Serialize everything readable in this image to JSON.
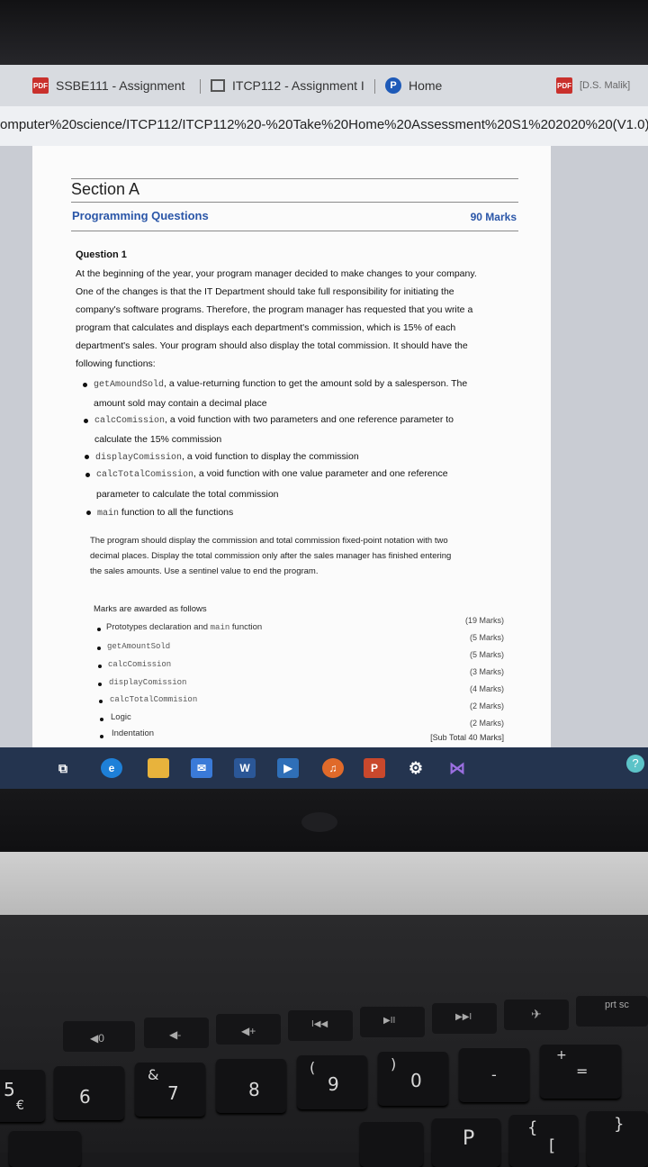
{
  "browser": {
    "tabs": [
      {
        "label": "SSBE111 - Assignment"
      },
      {
        "label": "ITCP112 - Assignment I"
      },
      {
        "label": "Home"
      },
      {
        "label": "[D.S. Malik] "
      }
    ],
    "address": "omputer%20science/ITCP112/ITCP112%20-%20Take%20Home%20Assessment%20S1%202020%20(V1.0).pdf"
  },
  "document": {
    "section_title": "Section A",
    "subsection_title": "Programming Questions",
    "subsection_marks": "90 Marks",
    "question_title": "Question 1",
    "intro_lines": [
      "At the beginning of the year, your program manager decided to make changes to your company.",
      "One of the changes is that the IT Department should take full responsibility for initiating the",
      "company's software programs. Therefore, the program manager has requested that you write a",
      "program that calculates and displays each department's commission, which is 15% of each",
      "department's sales. Your program should also display the total commission. It should have the",
      "following functions:"
    ],
    "functions": [
      {
        "code": "getAmoundSold",
        "text": ", a value-returning function to get the amount sold by a salesperson. The",
        "cont": "amount sold may contain a decimal place"
      },
      {
        "code": "calcComission",
        "text": ", a void function with two parameters and one reference parameter to",
        "cont": "calculate the 15% commission"
      },
      {
        "code": "displayComission",
        "text": ", a void function to display the commission",
        "cont": ""
      },
      {
        "code": "calcTotalComission",
        "text": ", a void function with one value parameter and one reference",
        "cont": "parameter to calculate the total commission"
      },
      {
        "code": "main",
        "text": " function to all the functions",
        "cont": ""
      }
    ],
    "display_lines": [
      "The program should display the commission and total commission fixed-point notation with two",
      "decimal places. Display the total commission only after the sales manager has finished entering",
      "the sales amounts. Use a sentinel value to end the program."
    ],
    "marks_heading": "Marks are awarded as follows",
    "marks": [
      {
        "pre": "Prototypes declaration and ",
        "code": "main",
        "post": " function",
        "value": "(19 Marks)"
      },
      {
        "pre": "",
        "code": "getAmountSold",
        "post": "",
        "value": "(5 Marks)"
      },
      {
        "pre": "",
        "code": "calcComission",
        "post": "",
        "value": "(5 Marks)"
      },
      {
        "pre": "",
        "code": "displayComission",
        "post": "",
        "value": "(3 Marks)"
      },
      {
        "pre": "",
        "code": "calcTotalCommision",
        "post": "",
        "value": "(4 Marks)"
      },
      {
        "pre": "Logic",
        "code": "",
        "post": "",
        "value": "(2 Marks)"
      },
      {
        "pre": "Indentation",
        "code": "",
        "post": "",
        "value": "(2 Marks)"
      }
    ],
    "subtotal": "[Sub Total 40 Marks]"
  },
  "taskbar": {
    "icons": [
      "task-view-icon",
      "edge-icon",
      "file-explorer-icon",
      "mail-icon",
      "word-icon",
      "media-player-icon",
      "groove-music-icon",
      "powerpoint-icon",
      "settings-icon",
      "visual-studio-icon"
    ],
    "word_label": "W",
    "ppt_label": "P",
    "help_label": "?"
  },
  "keyboard": {
    "fn_keys": [
      "f4",
      "f5",
      "f6",
      "f7",
      "f8",
      "f9",
      "f10",
      "f11",
      "f12",
      "prt sc"
    ],
    "fn_symbols": [
      "◀0",
      "◀-",
      "◀+",
      "I◀◀",
      "▶II",
      "▶▶I",
      "✈"
    ],
    "number_keys": [
      "5",
      "6",
      "7",
      "8",
      "9",
      "0"
    ],
    "shift_symbols": [
      "&",
      "(",
      ")",
      "_",
      "+"
    ],
    "misc": [
      "€",
      "P",
      "{",
      "[",
      "}",
      "-",
      "="
    ]
  }
}
